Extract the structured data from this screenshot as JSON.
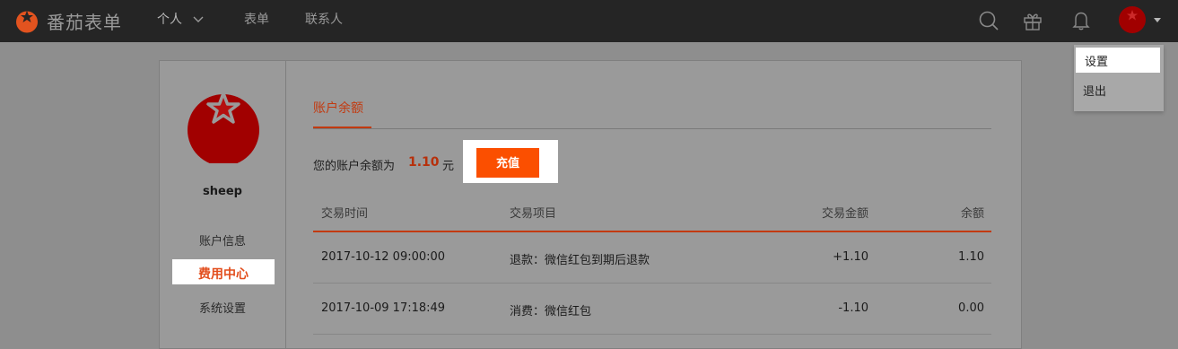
{
  "app": {
    "name": "番茄表单"
  },
  "nav": {
    "personal": "个人",
    "forms": "表单",
    "contacts": "联系人"
  },
  "topbar_icons": [
    "search-icon",
    "gift-icon",
    "bell-icon"
  ],
  "user_menu": {
    "settings": "设置",
    "logout": "退出"
  },
  "profile": {
    "username": "sheep"
  },
  "sidebar": {
    "account_info": "账户信息",
    "fee_center": "费用中心",
    "system_settings": "系统设置"
  },
  "balance": {
    "tab_title": "账户余额",
    "label": "您的账户余额为",
    "amount": "1.10",
    "unit": "元",
    "recharge_label": "充值"
  },
  "table": {
    "headers": {
      "time": "交易时间",
      "item": "交易项目",
      "amount": "交易金额",
      "balance": "余额"
    },
    "rows": [
      {
        "time": "2017-10-12 09:00:00",
        "item": "退款：微信红包到期后退款",
        "amount": "+1.10",
        "balance": "1.10"
      },
      {
        "time": "2017-10-09 17:18:49",
        "item": "消费：微信红包",
        "amount": "-1.10",
        "balance": "0.00"
      }
    ]
  },
  "colors": {
    "accent": "#fb4f00",
    "brand_red": "#a10000",
    "topbar": "#252525"
  }
}
